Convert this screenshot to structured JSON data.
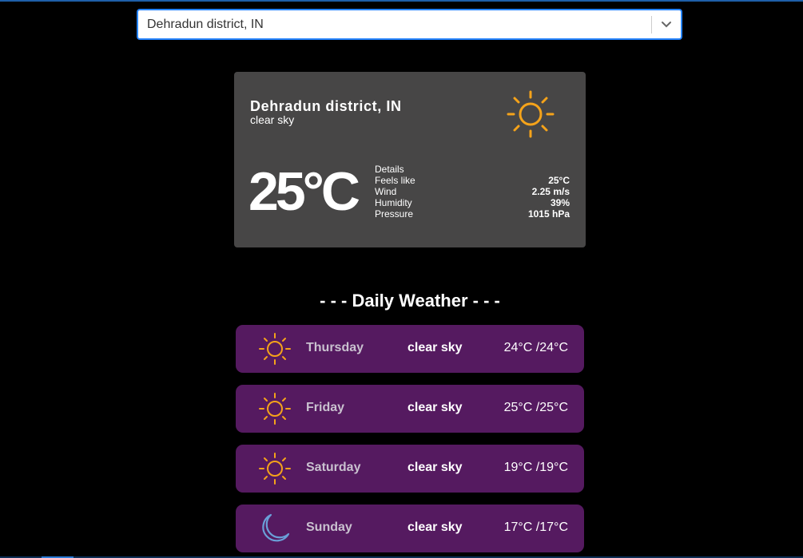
{
  "search": {
    "selected_value": "Dehradun district, IN"
  },
  "current": {
    "city": "Dehradun district, IN",
    "description": "clear sky",
    "temperature": "25°C",
    "icon": "sun-icon",
    "details": {
      "header": "Details",
      "rows": [
        {
          "label": "Feels like",
          "value": "25°C"
        },
        {
          "label": "Wind",
          "value": "2.25 m/s"
        },
        {
          "label": "Humidity",
          "value": "39%"
        },
        {
          "label": "Pressure",
          "value": "1015 hPa"
        }
      ]
    }
  },
  "daily": {
    "title": "- - - Daily Weather - - -",
    "items": [
      {
        "day": "Thursday",
        "description": "clear sky",
        "range": "24°C /24°C",
        "icon": "sun-icon"
      },
      {
        "day": "Friday",
        "description": "clear sky",
        "range": "25°C /25°C",
        "icon": "sun-icon"
      },
      {
        "day": "Saturday",
        "description": "clear sky",
        "range": "19°C /19°C",
        "icon": "sun-icon"
      },
      {
        "day": "Sunday",
        "description": "clear sky",
        "range": "17°C /17°C",
        "icon": "moon-icon"
      }
    ]
  },
  "colors": {
    "background": "#000000",
    "card": "#474646",
    "daily_item": "#551a60",
    "sun": "#f5a31a",
    "moon": "#6a9fd8",
    "focus_border": "#2684ff"
  }
}
